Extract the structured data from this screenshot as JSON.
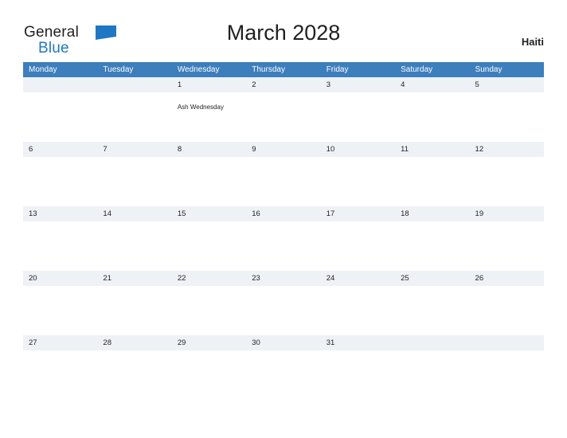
{
  "logo": {
    "word_one": "General",
    "word_two": "Blue",
    "flag_icon": "blue-flag-icon",
    "blue": "#1f77c4"
  },
  "header": {
    "title": "March 2028",
    "country": "Haiti"
  },
  "calendar": {
    "header_bg": "#3d7ebd",
    "row_shade": "#eef1f5",
    "day_names": [
      "Monday",
      "Tuesday",
      "Wednesday",
      "Thursday",
      "Friday",
      "Saturday",
      "Sunday"
    ],
    "weeks": [
      [
        {
          "day": "",
          "event": ""
        },
        {
          "day": "",
          "event": ""
        },
        {
          "day": "1",
          "event": "Ash Wednesday"
        },
        {
          "day": "2",
          "event": ""
        },
        {
          "day": "3",
          "event": ""
        },
        {
          "day": "4",
          "event": ""
        },
        {
          "day": "5",
          "event": ""
        }
      ],
      [
        {
          "day": "6",
          "event": ""
        },
        {
          "day": "7",
          "event": ""
        },
        {
          "day": "8",
          "event": ""
        },
        {
          "day": "9",
          "event": ""
        },
        {
          "day": "10",
          "event": ""
        },
        {
          "day": "11",
          "event": ""
        },
        {
          "day": "12",
          "event": ""
        }
      ],
      [
        {
          "day": "13",
          "event": ""
        },
        {
          "day": "14",
          "event": ""
        },
        {
          "day": "15",
          "event": ""
        },
        {
          "day": "16",
          "event": ""
        },
        {
          "day": "17",
          "event": ""
        },
        {
          "day": "18",
          "event": ""
        },
        {
          "day": "19",
          "event": ""
        }
      ],
      [
        {
          "day": "20",
          "event": ""
        },
        {
          "day": "21",
          "event": ""
        },
        {
          "day": "22",
          "event": ""
        },
        {
          "day": "23",
          "event": ""
        },
        {
          "day": "24",
          "event": ""
        },
        {
          "day": "25",
          "event": ""
        },
        {
          "day": "26",
          "event": ""
        }
      ],
      [
        {
          "day": "27",
          "event": ""
        },
        {
          "day": "28",
          "event": ""
        },
        {
          "day": "29",
          "event": ""
        },
        {
          "day": "30",
          "event": ""
        },
        {
          "day": "31",
          "event": ""
        },
        {
          "day": "",
          "event": ""
        },
        {
          "day": "",
          "event": ""
        }
      ]
    ]
  }
}
